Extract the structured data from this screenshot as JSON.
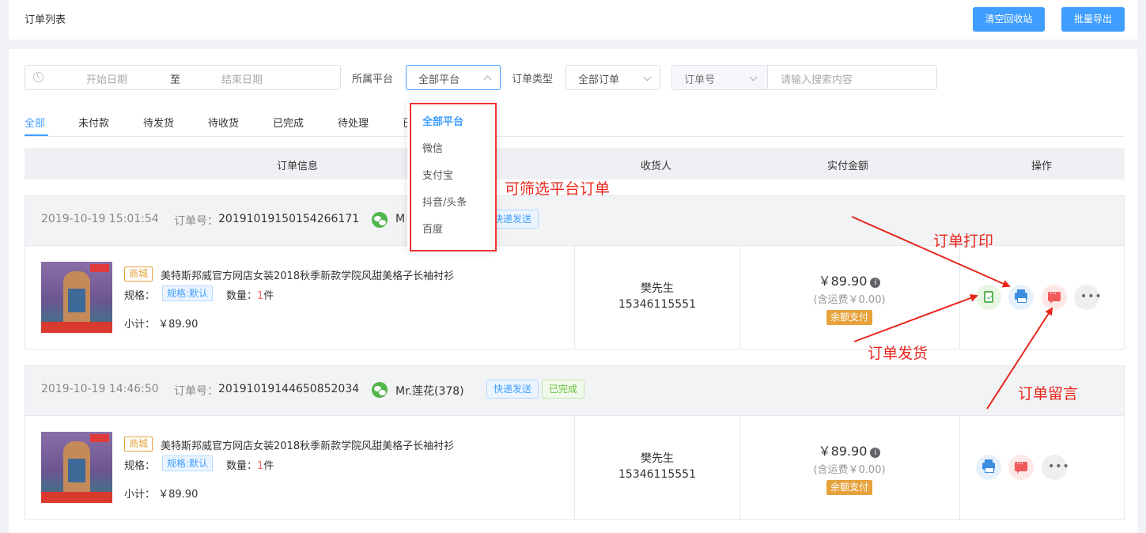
{
  "header": {
    "title": "订单列表",
    "buttons": [
      "清空回收站",
      "批量导出"
    ]
  },
  "filters": {
    "start_placeholder": "开始日期",
    "separator": "至",
    "end_placeholder": "结束日期",
    "platform_label": "所属平台",
    "platform_value": "全部平台",
    "type_label": "订单类型",
    "type_value": "全部订单",
    "search_field": "订单号",
    "search_placeholder": "请输入搜索内容"
  },
  "tabs": [
    "全部",
    "未付款",
    "待发货",
    "待收货",
    "已完成",
    "待处理",
    "已"
  ],
  "active_tab": 0,
  "table_headers": [
    "订单信息",
    "收货人",
    "实付金额",
    "操作"
  ],
  "platform_dropdown": {
    "options": [
      "全部平台",
      "微信",
      "支付宝",
      "抖音/头条",
      "百度"
    ],
    "selected": 0
  },
  "orders": [
    {
      "time": "2019-10-19 15:01:54",
      "order_no_label": "订单号：",
      "order_no": "20191019150154266171",
      "buyer": "M",
      "tags": [
        "快递发送"
      ],
      "mall_tag": "商城",
      "product_name": "美特斯邦威官方网店女装2018秋季新款学院风甜美格子长袖衬衫",
      "spec_label": "规格：",
      "spec_value": "规格:默认",
      "qty_label": "数量：",
      "qty_value": "1",
      "qty_unit": "件",
      "subtotal": "小计： ￥89.90",
      "receiver_name": "樊先生",
      "receiver_phone": "15346115551",
      "amount": "￥89.90",
      "shipping": "(含运费￥0.00)",
      "pay_method": "余额支付",
      "actions": [
        "clipboard-check-icon",
        "printer-icon",
        "message-icon",
        "more-icon"
      ]
    },
    {
      "time": "2019-10-19 14:46:50",
      "order_no_label": "订单号：",
      "order_no": "20191019144650852034",
      "buyer": "Mr.莲花(378)",
      "tags": [
        "快递发送",
        "已完成"
      ],
      "mall_tag": "商城",
      "product_name": "美特斯邦威官方网店女装2018秋季新款学院风甜美格子长袖衬衫",
      "spec_label": "规格：",
      "spec_value": "规格:默认",
      "qty_label": "数量：",
      "qty_value": "1",
      "qty_unit": "件",
      "subtotal": "小计： ￥89.90",
      "receiver_name": "樊先生",
      "receiver_phone": "15346115551",
      "amount": "￥89.90",
      "shipping": "(含运费￥0.00)",
      "pay_method": "余额支付",
      "actions": [
        "printer-icon",
        "message-icon",
        "more-icon"
      ]
    }
  ],
  "annotations": {
    "filter_platform": "可筛选平台订单",
    "print": "订单打印",
    "ship": "订单发货",
    "message": "订单留言"
  },
  "colors": {
    "primary": "#409eff",
    "annotation": "#e8261c",
    "warning": "#e6a23c",
    "success": "#67c23a",
    "danger": "#f56c6c"
  }
}
